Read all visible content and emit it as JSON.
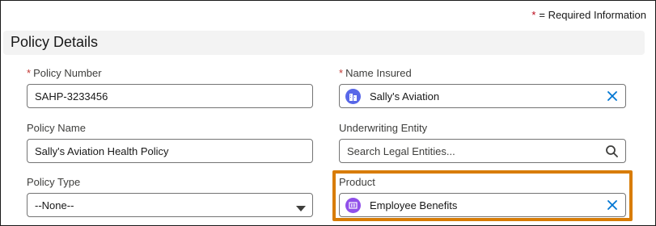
{
  "required_info": {
    "star": "*",
    "text": "= Required Information"
  },
  "section": {
    "title": "Policy Details"
  },
  "fields": {
    "policy_number": {
      "required": "*",
      "label": "Policy Number",
      "value": "SAHP-3233456"
    },
    "name_insured": {
      "required": "*",
      "label": "Name Insured",
      "value": "Sally's Aviation",
      "icon": "building-icon",
      "icon_color": "#5867e8"
    },
    "policy_name": {
      "label": "Policy Name",
      "value": "Sally's Aviation Health Policy"
    },
    "underwriting_entity": {
      "label": "Underwriting Entity",
      "placeholder": "Search Legal Entities...",
      "icon": "search-icon"
    },
    "policy_type": {
      "label": "Policy Type",
      "value": "--None--",
      "icon": "chevron-down-icon"
    },
    "product": {
      "label": "Product",
      "value": "Employee Benefits",
      "icon": "product-icon",
      "icon_color": "#9050e9"
    }
  },
  "colors": {
    "required_star": "#ba0517",
    "highlight": "#d87c06",
    "clear_icon": "#0176d3"
  }
}
